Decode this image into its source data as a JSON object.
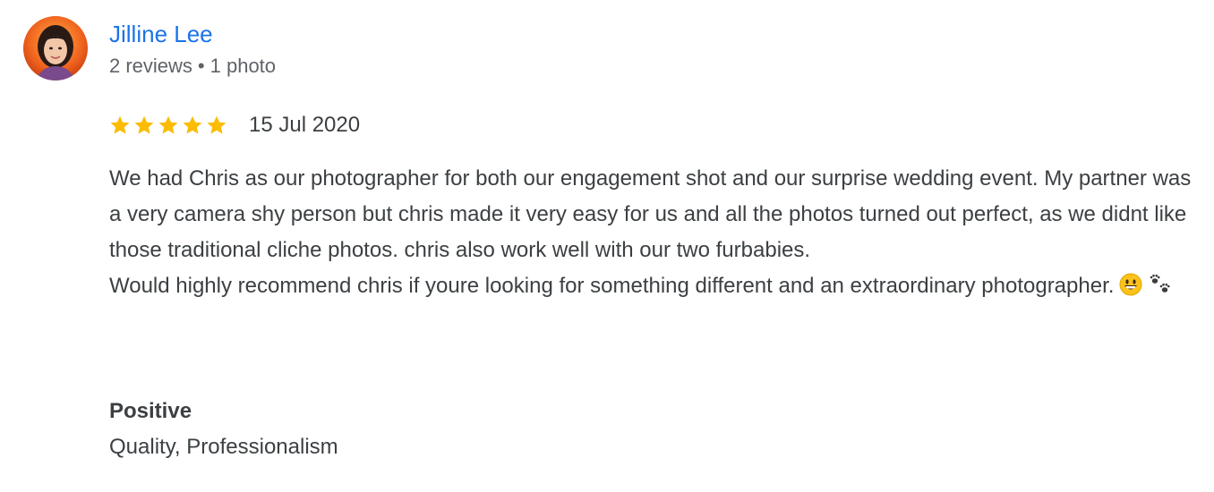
{
  "reviewer": {
    "name": "Jilline Lee",
    "reviews_count": "2 reviews",
    "separator": "•",
    "photos_count": "1 photo",
    "avatar_icon": "profile-photo"
  },
  "review": {
    "rating": 5,
    "rating_max": 5,
    "star_color": "#fbbc04",
    "date": "15 Jul 2020",
    "paragraph_1": "We had Chris as our photographer for both our engagement shot and our surprise wedding event. My partner was a very camera shy person but chris made it very easy for us and all the photos turned out perfect, as we didnt like those traditional cliche photos. chris also work well with our two furbabies.",
    "paragraph_2": "Would highly recommend chris if youre looking for something different and an extraordinary photographer.",
    "emoji_1": "grinning-face-emoji",
    "emoji_2": "paw-prints-emoji"
  },
  "highlights": {
    "heading": "Positive",
    "value": "Quality, Professionalism"
  },
  "colors": {
    "name_link": "#1a73e8",
    "meta_text": "#5f6368",
    "body_text": "#3c4043"
  }
}
